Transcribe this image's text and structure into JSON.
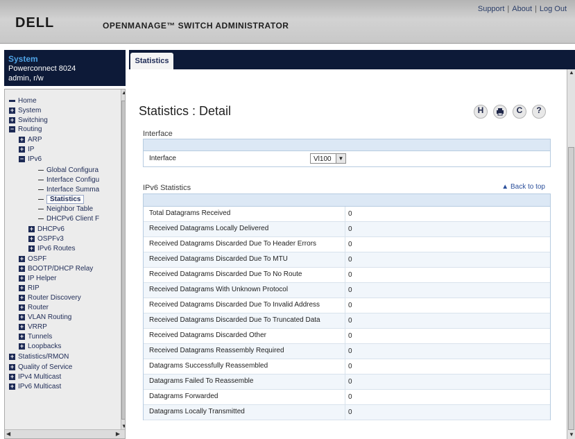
{
  "header": {
    "logo": "DELL",
    "product": "OPENMANAGE™ SWITCH ADMINISTRATOR",
    "links": [
      "Support",
      "About",
      "Log Out"
    ]
  },
  "system": {
    "title": "System",
    "model": "Powerconnect 8024",
    "user": "admin, r/w"
  },
  "nav": {
    "items": [
      {
        "label": "Home"
      },
      {
        "label": "System",
        "toggle": "+"
      },
      {
        "label": "Switching",
        "toggle": "+"
      },
      {
        "label": "Routing",
        "toggle": "−"
      },
      {
        "label": "ARP",
        "toggle": "+"
      },
      {
        "label": "IP",
        "toggle": "+"
      },
      {
        "label": "IPv6",
        "toggle": "−"
      },
      {
        "label": "Global Configura"
      },
      {
        "label": "Interface Configu"
      },
      {
        "label": "Interface Summa"
      },
      {
        "label": "Statistics"
      },
      {
        "label": "Neighbor Table"
      },
      {
        "label": "DHCPv6 Client F"
      },
      {
        "label": "DHCPv6",
        "toggle": "+"
      },
      {
        "label": "OSPFv3",
        "toggle": "+"
      },
      {
        "label": "IPv6 Routes",
        "toggle": "+"
      },
      {
        "label": "OSPF",
        "toggle": "+"
      },
      {
        "label": "BOOTP/DHCP Relay",
        "toggle": "+"
      },
      {
        "label": "IP Helper",
        "toggle": "+"
      },
      {
        "label": "RIP",
        "toggle": "+"
      },
      {
        "label": "Router Discovery",
        "toggle": "+"
      },
      {
        "label": "Router",
        "toggle": "+"
      },
      {
        "label": "VLAN Routing",
        "toggle": "+"
      },
      {
        "label": "VRRP",
        "toggle": "+"
      },
      {
        "label": "Tunnels",
        "toggle": "+"
      },
      {
        "label": "Loopbacks",
        "toggle": "+"
      },
      {
        "label": "Statistics/RMON",
        "toggle": "+"
      },
      {
        "label": "Quality of Service",
        "toggle": "+"
      },
      {
        "label": "IPv4 Multicast",
        "toggle": "+"
      },
      {
        "label": "IPv6 Multicast",
        "toggle": "+"
      }
    ]
  },
  "tab": {
    "label": "Statistics"
  },
  "page": {
    "title": "Statistics : Detail"
  },
  "toolbar": {
    "save_icon": "H",
    "print_icon": "print-icon",
    "refresh_icon": "C",
    "help_icon": "?"
  },
  "interface_section": {
    "label": "Interface",
    "field_label": "Interface",
    "value": "Vl100"
  },
  "ipv6_section": {
    "label": "IPv6 Statistics",
    "back_to_top": "Back to top",
    "rows": [
      {
        "name": "Total Datagrams Received",
        "value": "0"
      },
      {
        "name": "Received Datagrams Locally Delivered",
        "value": "0"
      },
      {
        "name": "Received Datagrams Discarded Due To Header Errors",
        "value": "0"
      },
      {
        "name": "Received Datagrams Discarded Due To MTU",
        "value": "0"
      },
      {
        "name": "Received Datagrams Discarded Due To No Route",
        "value": "0"
      },
      {
        "name": "Received Datagrams With Unknown Protocol",
        "value": "0"
      },
      {
        "name": "Received Datagrams Discarded Due To Invalid Address",
        "value": "0"
      },
      {
        "name": "Received Datagrams Discarded Due To Truncated Data",
        "value": "0"
      },
      {
        "name": "Received Datagrams Discarded Other",
        "value": "0"
      },
      {
        "name": "Received Datagrams Reassembly Required",
        "value": "0"
      },
      {
        "name": "Datagrams Successfully Reassembled",
        "value": "0"
      },
      {
        "name": "Datagrams Failed To Reassemble",
        "value": "0"
      },
      {
        "name": "Datagrams Forwarded",
        "value": "0"
      },
      {
        "name": "Datagrams Locally Transmitted",
        "value": "0"
      }
    ]
  }
}
